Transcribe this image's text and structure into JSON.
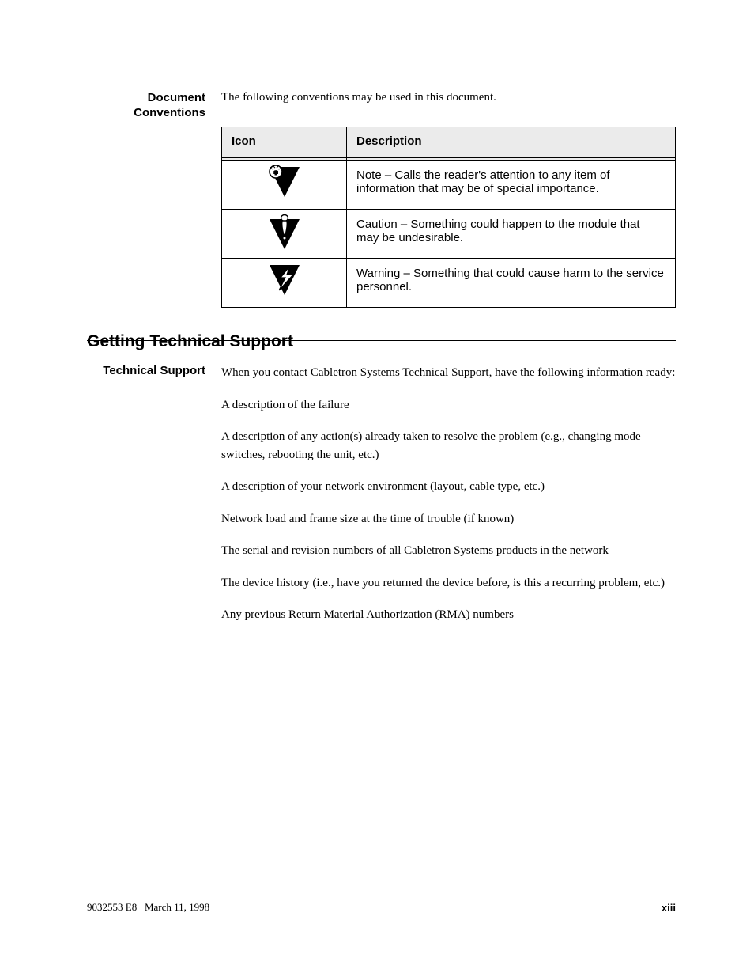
{
  "sidebar": {
    "label": "Document Conventions"
  },
  "intro": "The following conventions may be used in this document.",
  "table": {
    "headers": {
      "icon": "Icon",
      "desc": "Description"
    },
    "rows": [
      {
        "icon_name": "note-icon",
        "desc": "Note – Calls the reader's attention to any item of information that may be of special importance."
      },
      {
        "icon_name": "caution-icon",
        "desc": "Caution – Something could happen to the module that may be undesirable."
      },
      {
        "icon_name": "warning-icon",
        "desc": "Warning – Something that could cause harm to the service personnel."
      }
    ]
  },
  "support": {
    "heading": "Getting Technical Support",
    "label": "Technical Support",
    "paragraphs": [
      "When you contact Cabletron Systems Technical Support, have the following information ready:",
      "A description of the failure",
      "A description of any action(s) already taken to resolve the problem (e.g., changing mode switches, rebooting the unit, etc.)",
      "A description of your network environment (layout, cable type, etc.)",
      "Network load and frame size at the time of trouble (if known)",
      "The serial and revision numbers of all Cabletron Systems products in the network",
      "The device history (i.e., have you returned the device before, is this a recurring problem, etc.)",
      "Any previous Return Material Authorization (RMA) numbers"
    ]
  },
  "footer": {
    "left": "9032553",
    "rev": "E8",
    "date": "March 11, 1998",
    "page": "xiii"
  }
}
